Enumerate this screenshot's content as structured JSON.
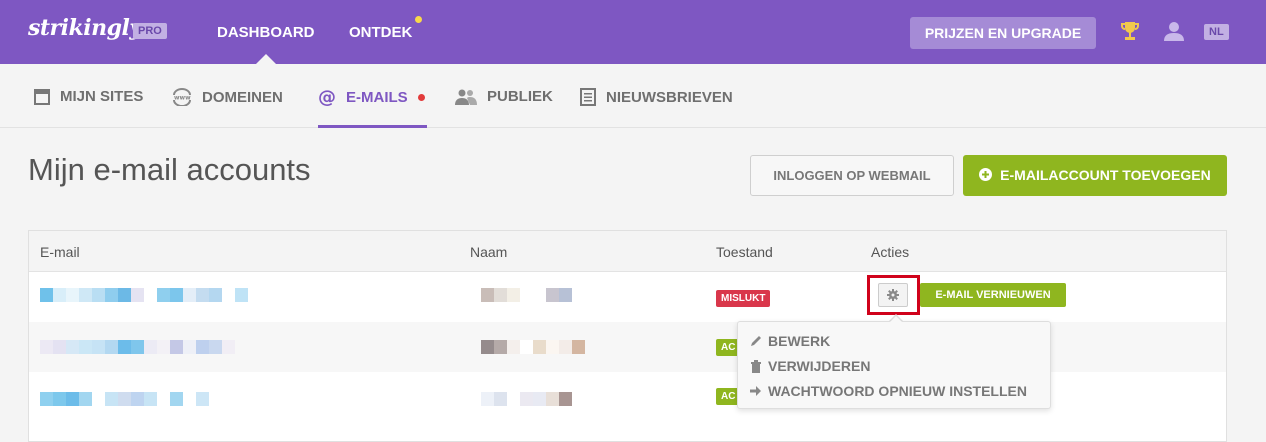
{
  "topbar": {
    "logo": "strikingly",
    "badge": "PRO",
    "nav": [
      "DASHBOARD",
      "ONTDEK"
    ],
    "upgrade_label": "PRIJZEN EN UPGRADE",
    "lang": "NL",
    "icons": [
      "trophy-icon",
      "user-icon"
    ]
  },
  "subnav": {
    "tabs": [
      {
        "label": "MIJN SITES",
        "icon": "browser-icon"
      },
      {
        "label": "DOMEINEN",
        "icon": "www-icon"
      },
      {
        "label": "E-MAILS",
        "icon": "at-icon",
        "active": true
      },
      {
        "label": "PUBLIEK",
        "icon": "users-icon"
      },
      {
        "label": "NIEUWSBRIEVEN",
        "icon": "newsletter-icon"
      }
    ]
  },
  "main": {
    "title": "Mijn e-mail accounts",
    "webmail_label": "INLOGGEN OP WEBMAIL",
    "add_label": "E-MAILACCOUNT TOEVOEGEN"
  },
  "table": {
    "headers": [
      "E-mail",
      "Naam",
      "Toestand",
      "Acties"
    ],
    "rows": [
      {
        "status": "MISLUKT",
        "status_type": "fail"
      },
      {
        "status": "AC",
        "status_type": "ok"
      },
      {
        "status": "AC",
        "status_type": "ok"
      }
    ],
    "renew_label": "E-MAIL VERNIEUWEN"
  },
  "dropdown": {
    "items": [
      {
        "label": "BEWERK",
        "icon": "pencil-icon"
      },
      {
        "label": "VERWIJDEREN",
        "icon": "trash-icon"
      },
      {
        "label": "WACHTWOORD OPNIEUW INSTELLEN",
        "icon": "arrow-right-icon"
      }
    ]
  },
  "colors": {
    "brand": "#7e57c2",
    "green": "#8fb61f",
    "red": "#d9374b"
  }
}
